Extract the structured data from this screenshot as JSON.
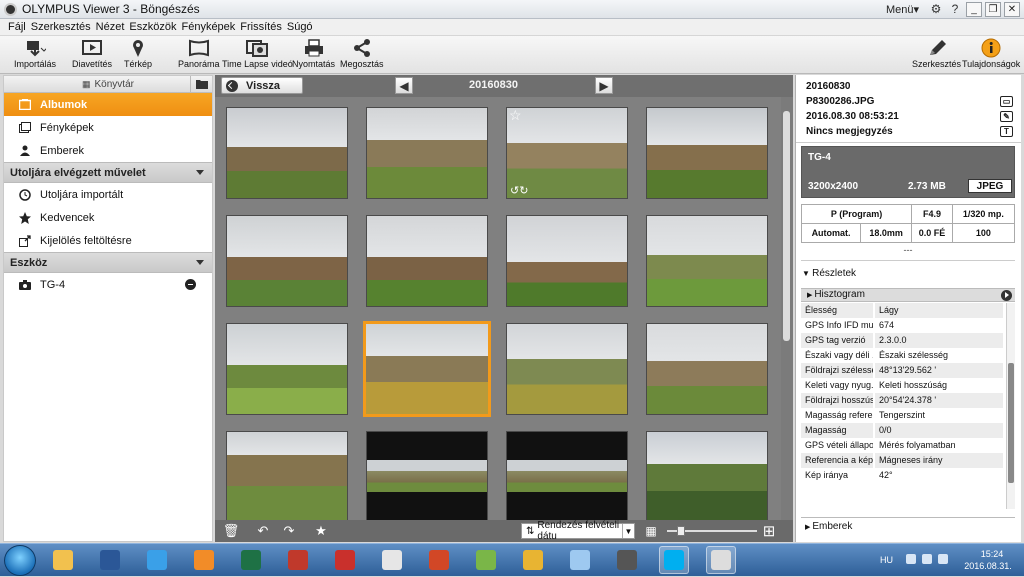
{
  "window": {
    "title": "OLYMPUS Viewer 3 - Böngészés",
    "menu_label": "Menü▾"
  },
  "menubar": [
    "Fájl",
    "Szerkesztés",
    "Nézet",
    "Eszközök",
    "Fényképek",
    "Frissítés",
    "Súgó"
  ],
  "toolbar": {
    "import": "Importálás",
    "slideshow": "Diavetítés",
    "map": "Térkép",
    "panorama": "Panoráma",
    "timelapse": "Time Lapse videó",
    "print": "Nyomtatás",
    "share": "Megosztás",
    "edit": "Szerkesztés",
    "properties": "Tulajdonságok"
  },
  "library": {
    "header": "Könyvtár",
    "items": [
      {
        "label": "Albumok",
        "icon": "album-icon",
        "active": true
      },
      {
        "label": "Fényképek",
        "icon": "photos-icon"
      },
      {
        "label": "Emberek",
        "icon": "person-icon"
      }
    ],
    "recent_section": "Utoljára elvégzett művelet",
    "recent_items": [
      {
        "label": "Utoljára importált",
        "icon": "clock-icon"
      },
      {
        "label": "Kedvencek",
        "icon": "star-icon"
      },
      {
        "label": "Kijelölés feltöltésre",
        "icon": "upload-icon"
      }
    ],
    "device_section": "Eszköz",
    "device_items": [
      {
        "label": "TG-4",
        "icon": "camera-icon"
      }
    ]
  },
  "browser": {
    "back_label": "Vissza",
    "current_folder": "20160830",
    "sort_label": "Rendezés felvételi dátu"
  },
  "info": {
    "folder": "20160830",
    "filename": "P8300286.JPG",
    "datetime": "2016.08.30 08:53:21",
    "comment": "Nincs megjegyzés",
    "camera": "TG-4",
    "resolution": "3200x2400",
    "filesize": "2.73 MB",
    "format": "JPEG",
    "exif_row1": [
      "P (Program)",
      "F4.9",
      "1/320 mp."
    ],
    "exif_row2": [
      "Automat.",
      "18.0mm",
      "0.0 FÉ",
      "100"
    ],
    "exif_dash": "---",
    "details_label": "Részletek",
    "histogram_label": "Hisztogram",
    "properties": [
      {
        "k": "Élesség",
        "v": "Lágy"
      },
      {
        "k": "GPS Info IFD mu...",
        "v": "674"
      },
      {
        "k": "GPS tag verzió",
        "v": "2.3.0.0"
      },
      {
        "k": "Északi vagy déli ...",
        "v": "Északi szélesség"
      },
      {
        "k": "Földrajzi szélesség",
        "v": "48°13'29.562 '"
      },
      {
        "k": "Keleti vagy nyug...",
        "v": "Keleti hosszúság"
      },
      {
        "k": "Földrajzi hosszúság",
        "v": "20°54'24.378 '"
      },
      {
        "k": "Magasság refere...",
        "v": "Tengerszint"
      },
      {
        "k": "Magasság",
        "v": "0/0"
      },
      {
        "k": "GPS vételi állapot",
        "v": "Mérés folyamatban"
      },
      {
        "k": "Referencia a kép...",
        "v": "Mágneses irány"
      },
      {
        "k": "Kép iránya",
        "v": "42°"
      }
    ],
    "people_label": "Emberek"
  },
  "taskbar": {
    "lang": "HU",
    "time": "15:24",
    "date": "2016.08.31."
  },
  "colors": {
    "accent": "#f29a1b",
    "center_bg": "#808080"
  }
}
